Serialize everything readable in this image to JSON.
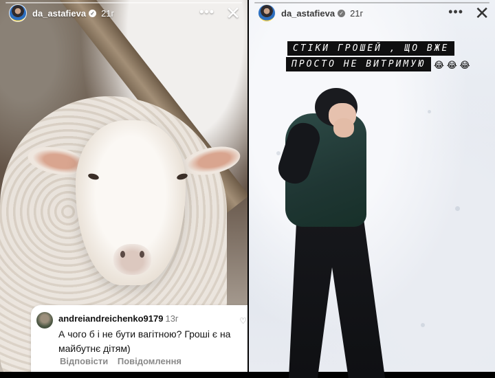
{
  "stories": [
    {
      "username": "da_astafieva",
      "time": "21г",
      "more_icon": "more-horizontal-icon",
      "close_icon": "close-icon",
      "photo": "sheep-closeup",
      "reply": {
        "username": "andreiandreichenko9179",
        "time": "13г",
        "text": "А чого б і не бути вагітною? Гроші є на майбутнє дітям)",
        "actions": [
          "Відповісти",
          "Повідомлення"
        ]
      }
    },
    {
      "username": "da_astafieva",
      "time": "21г",
      "more_icon": "more-horizontal-icon",
      "close_icon": "close-icon",
      "photo": "woman-lying-in-snow",
      "caption": {
        "line1": "СТІКИ ГРОШЕЙ , ЩО ВЖЕ",
        "line2": "ПРОСТО НЕ ВИТРИМУЮ",
        "emoji": "😂 😂 😂"
      }
    }
  ],
  "colors": {
    "reply_card_bg": "#ffffff",
    "caption_bg": "#0f0f10",
    "caption_text": "#ffffff"
  }
}
